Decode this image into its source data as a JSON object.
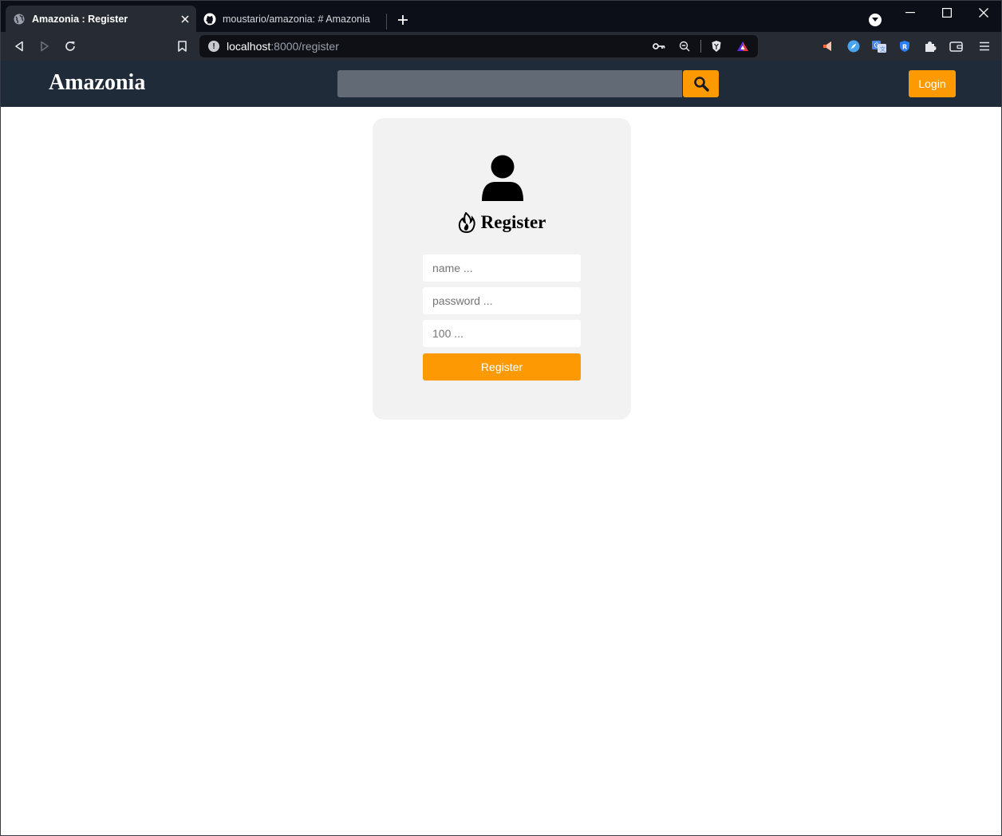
{
  "browser": {
    "tabs": [
      {
        "title": "Amazonia : Register",
        "icon": "globe-icon",
        "active": true
      },
      {
        "title": "moustario/amazonia: # Amazonia",
        "icon": "github-icon",
        "active": false
      }
    ],
    "url": {
      "host": "localhost",
      "path": ":8000/register"
    }
  },
  "header": {
    "brand": "Amazonia",
    "search": {
      "placeholder": "",
      "value": ""
    },
    "login_label": "Login"
  },
  "register_form": {
    "title": "Register",
    "fields": {
      "name": {
        "placeholder": "name ..."
      },
      "password": {
        "placeholder": "password ..."
      },
      "amount": {
        "placeholder": "100 ..."
      }
    },
    "submit_label": "Register"
  },
  "colors": {
    "accent": "#fd9a03",
    "header_bg": "#202b3a",
    "card_bg": "#f2f2f2"
  }
}
